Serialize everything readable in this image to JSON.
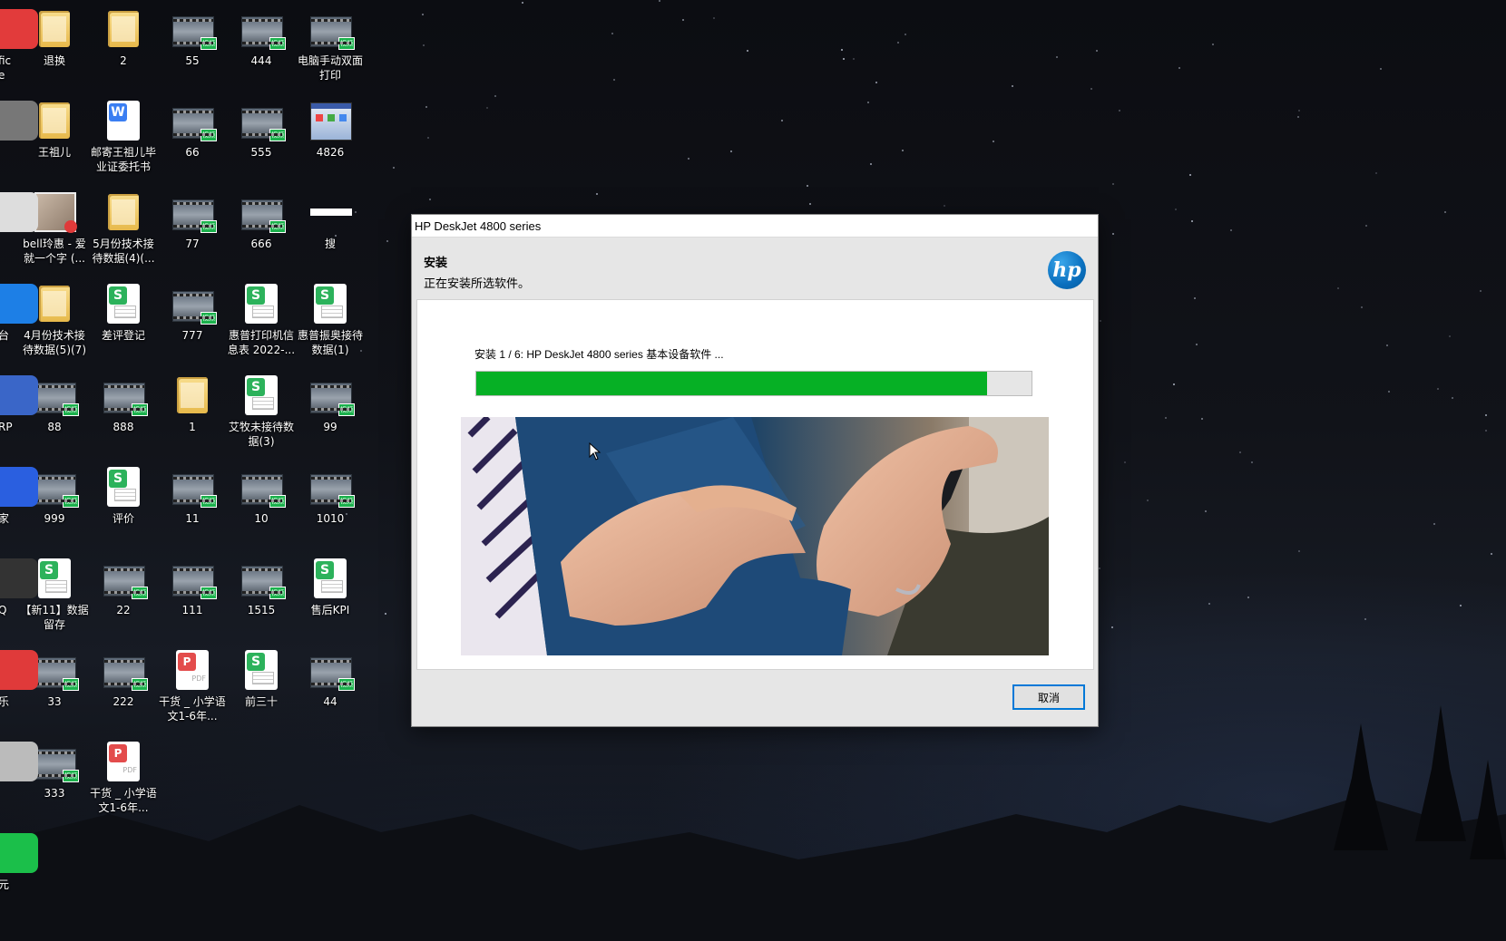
{
  "desktop": {
    "edge_labels": [
      "fice",
      "",
      "",
      "台",
      "RP",
      "家",
      "Q",
      "乐",
      "",
      "元"
    ],
    "icons": [
      {
        "label": "退换",
        "icon": "folder-icon"
      },
      {
        "label": "2",
        "icon": "folder-icon"
      },
      {
        "label": "55",
        "icon": "video-icon"
      },
      {
        "label": "444",
        "icon": "video-icon"
      },
      {
        "label": "电脑手动双面打印",
        "icon": "video-icon"
      },
      {
        "label": "王祖儿",
        "icon": "folder-icon"
      },
      {
        "label": "邮寄王祖儿毕业证委托书",
        "icon": "word-doc-icon"
      },
      {
        "label": "66",
        "icon": "video-icon"
      },
      {
        "label": "555",
        "icon": "video-icon"
      },
      {
        "label": "4826",
        "icon": "installer-icon"
      },
      {
        "label": "bell玲惠 - 爱就一个字 (...",
        "icon": "music-icon"
      },
      {
        "label": "5月份技术接待数据(4)(...",
        "icon": "folder-icon"
      },
      {
        "label": "77",
        "icon": "video-icon"
      },
      {
        "label": "666",
        "icon": "video-icon"
      },
      {
        "label": "搜",
        "icon": "shortcut-icon"
      },
      {
        "label": "4月份技术接待数据(5)(7)",
        "icon": "folder-icon"
      },
      {
        "label": "差评登记",
        "icon": "spreadsheet-icon"
      },
      {
        "label": "777",
        "icon": "video-icon"
      },
      {
        "label": "惠普打印机信息表 2022-...",
        "icon": "spreadsheet-icon"
      },
      {
        "label": "惠普振奥接待数据(1)",
        "icon": "spreadsheet-icon"
      },
      {
        "label": "88",
        "icon": "video-icon"
      },
      {
        "label": "888",
        "icon": "video-icon"
      },
      {
        "label": "1",
        "icon": "folder-icon"
      },
      {
        "label": "艾牧未接待数据(3)",
        "icon": "spreadsheet-icon"
      },
      {
        "label": "99",
        "icon": "video-icon"
      },
      {
        "label": "999",
        "icon": "video-icon"
      },
      {
        "label": "评价",
        "icon": "spreadsheet-icon"
      },
      {
        "label": "11",
        "icon": "video-icon"
      },
      {
        "label": "10",
        "icon": "video-icon"
      },
      {
        "label": "1010",
        "icon": "video-icon"
      },
      {
        "label": "【新11】数据留存",
        "icon": "spreadsheet-icon"
      },
      {
        "label": "22",
        "icon": "video-icon"
      },
      {
        "label": "111",
        "icon": "video-icon"
      },
      {
        "label": "1515",
        "icon": "video-icon"
      },
      {
        "label": "售后KPI",
        "icon": "spreadsheet-icon"
      },
      {
        "label": "33",
        "icon": "video-icon"
      },
      {
        "label": "222",
        "icon": "video-icon"
      },
      {
        "label": "干货 _ 小学语文1-6年...",
        "icon": "pdf-icon"
      },
      {
        "label": "前三十",
        "icon": "spreadsheet-icon"
      },
      {
        "label": "44",
        "icon": "video-icon"
      },
      {
        "label": "333",
        "icon": "video-icon"
      },
      {
        "label": "干货 _ 小学语文1-6年...",
        "icon": "pdf-icon"
      }
    ],
    "video_badge": "视频"
  },
  "dialog": {
    "window_title": "HP DeskJet 4800 series",
    "header_title": "安装",
    "header_subtitle": "正在安装所选软件。",
    "logo_text": "hp",
    "step_text": "安装 1 / 6: HP DeskJet 4800 series 基本设备软件 ...",
    "progress_fraction": 0.92,
    "progress_color": "#06b025",
    "cancel_label": "取消",
    "accent_color": "#0078d7"
  }
}
